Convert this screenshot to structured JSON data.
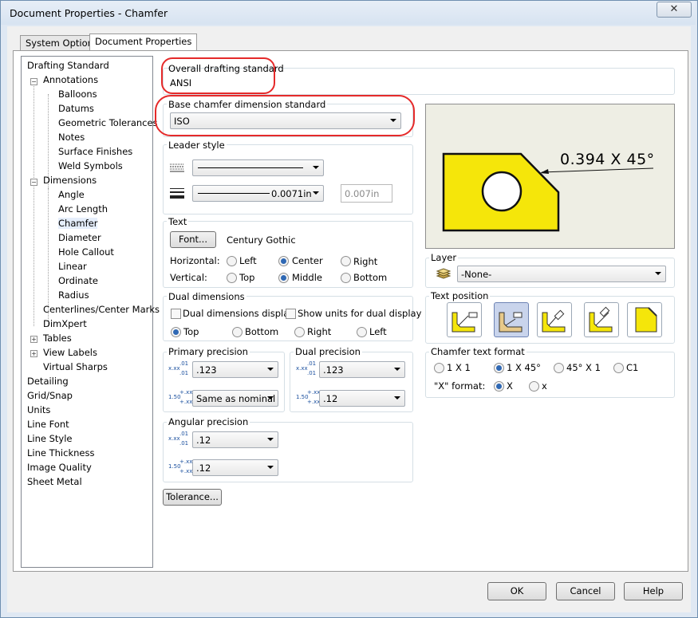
{
  "window": {
    "title": "Document Properties - Chamfer",
    "close_glyph": "✕"
  },
  "tabs": [
    {
      "label": "System Options"
    },
    {
      "label": "Document Properties"
    }
  ],
  "tree": {
    "items": [
      "Drafting Standard",
      "Annotations",
      "Balloons",
      "Datums",
      "Geometric Tolerances",
      "Notes",
      "Surface Finishes",
      "Weld Symbols",
      "Dimensions",
      "Angle",
      "Arc Length",
      "Chamfer",
      "Diameter",
      "Hole Callout",
      "Linear",
      "Ordinate",
      "Radius",
      "Centerlines/Center Marks",
      "DimXpert",
      "Tables",
      "View Labels",
      "Virtual Sharps",
      "Detailing",
      "Grid/Snap",
      "Units",
      "Line Font",
      "Line Style",
      "Line Thickness",
      "Image Quality",
      "Sheet Metal"
    ],
    "selected": "Chamfer"
  },
  "overall": {
    "label": "Overall drafting standard",
    "value": "ANSI"
  },
  "base": {
    "label": "Base chamfer dimension standard",
    "value": "ISO"
  },
  "leader": {
    "label": "Leader style",
    "thickness": "0.0071in",
    "custom": "0.007in"
  },
  "text": {
    "label": "Text",
    "font_button": "Font...",
    "font_name": "Century Gothic",
    "horizontal_label": "Horizontal:",
    "vertical_label": "Vertical:",
    "h_options": [
      "Left",
      "Center",
      "Right"
    ],
    "h_selected": "Center",
    "v_options": [
      "Top",
      "Middle",
      "Bottom"
    ],
    "v_selected": "Middle"
  },
  "dual": {
    "label": "Dual dimensions",
    "display": "Dual dimensions display",
    "show_units": "Show units for dual display",
    "positions": [
      "Top",
      "Bottom",
      "Right",
      "Left"
    ],
    "selected": "Top"
  },
  "primary": {
    "label": "Primary precision",
    "value": ".123",
    "tolerance": "Same as nominal"
  },
  "dualprec": {
    "label": "Dual precision",
    "value": ".123",
    "tolerance": ".12"
  },
  "angular": {
    "label": "Angular precision",
    "value": ".12",
    "tolerance": ".12"
  },
  "precision_icon": {
    "top_value": "x.xx",
    "top_exp": ".01",
    "bottom_value": "1.50",
    "bottom_exp": "+.xx"
  },
  "tolerance_button": "Tolerance...",
  "preview": {
    "dimension_text": "0.394 X 45°",
    "fill_color": "#f5e60a"
  },
  "layer": {
    "label": "Layer",
    "value": "-None-"
  },
  "text_position": {
    "label": "Text position",
    "buttons": 5,
    "selected_index": 1
  },
  "chamfer_format": {
    "label": "Chamfer text format",
    "options": [
      "1 X 1",
      "1 X 45°",
      "45° X 1",
      "C1"
    ],
    "selected": "1 X 45°",
    "x_format_label": "\"X\" format:",
    "x_options": [
      "X",
      "x"
    ],
    "x_selected": "X"
  },
  "footer": {
    "ok": "OK",
    "cancel": "Cancel",
    "help": "Help"
  },
  "colors": {
    "accent": "#2f68b4",
    "annotation": "#e52a2a",
    "preview_bg": "#eeeee4"
  }
}
